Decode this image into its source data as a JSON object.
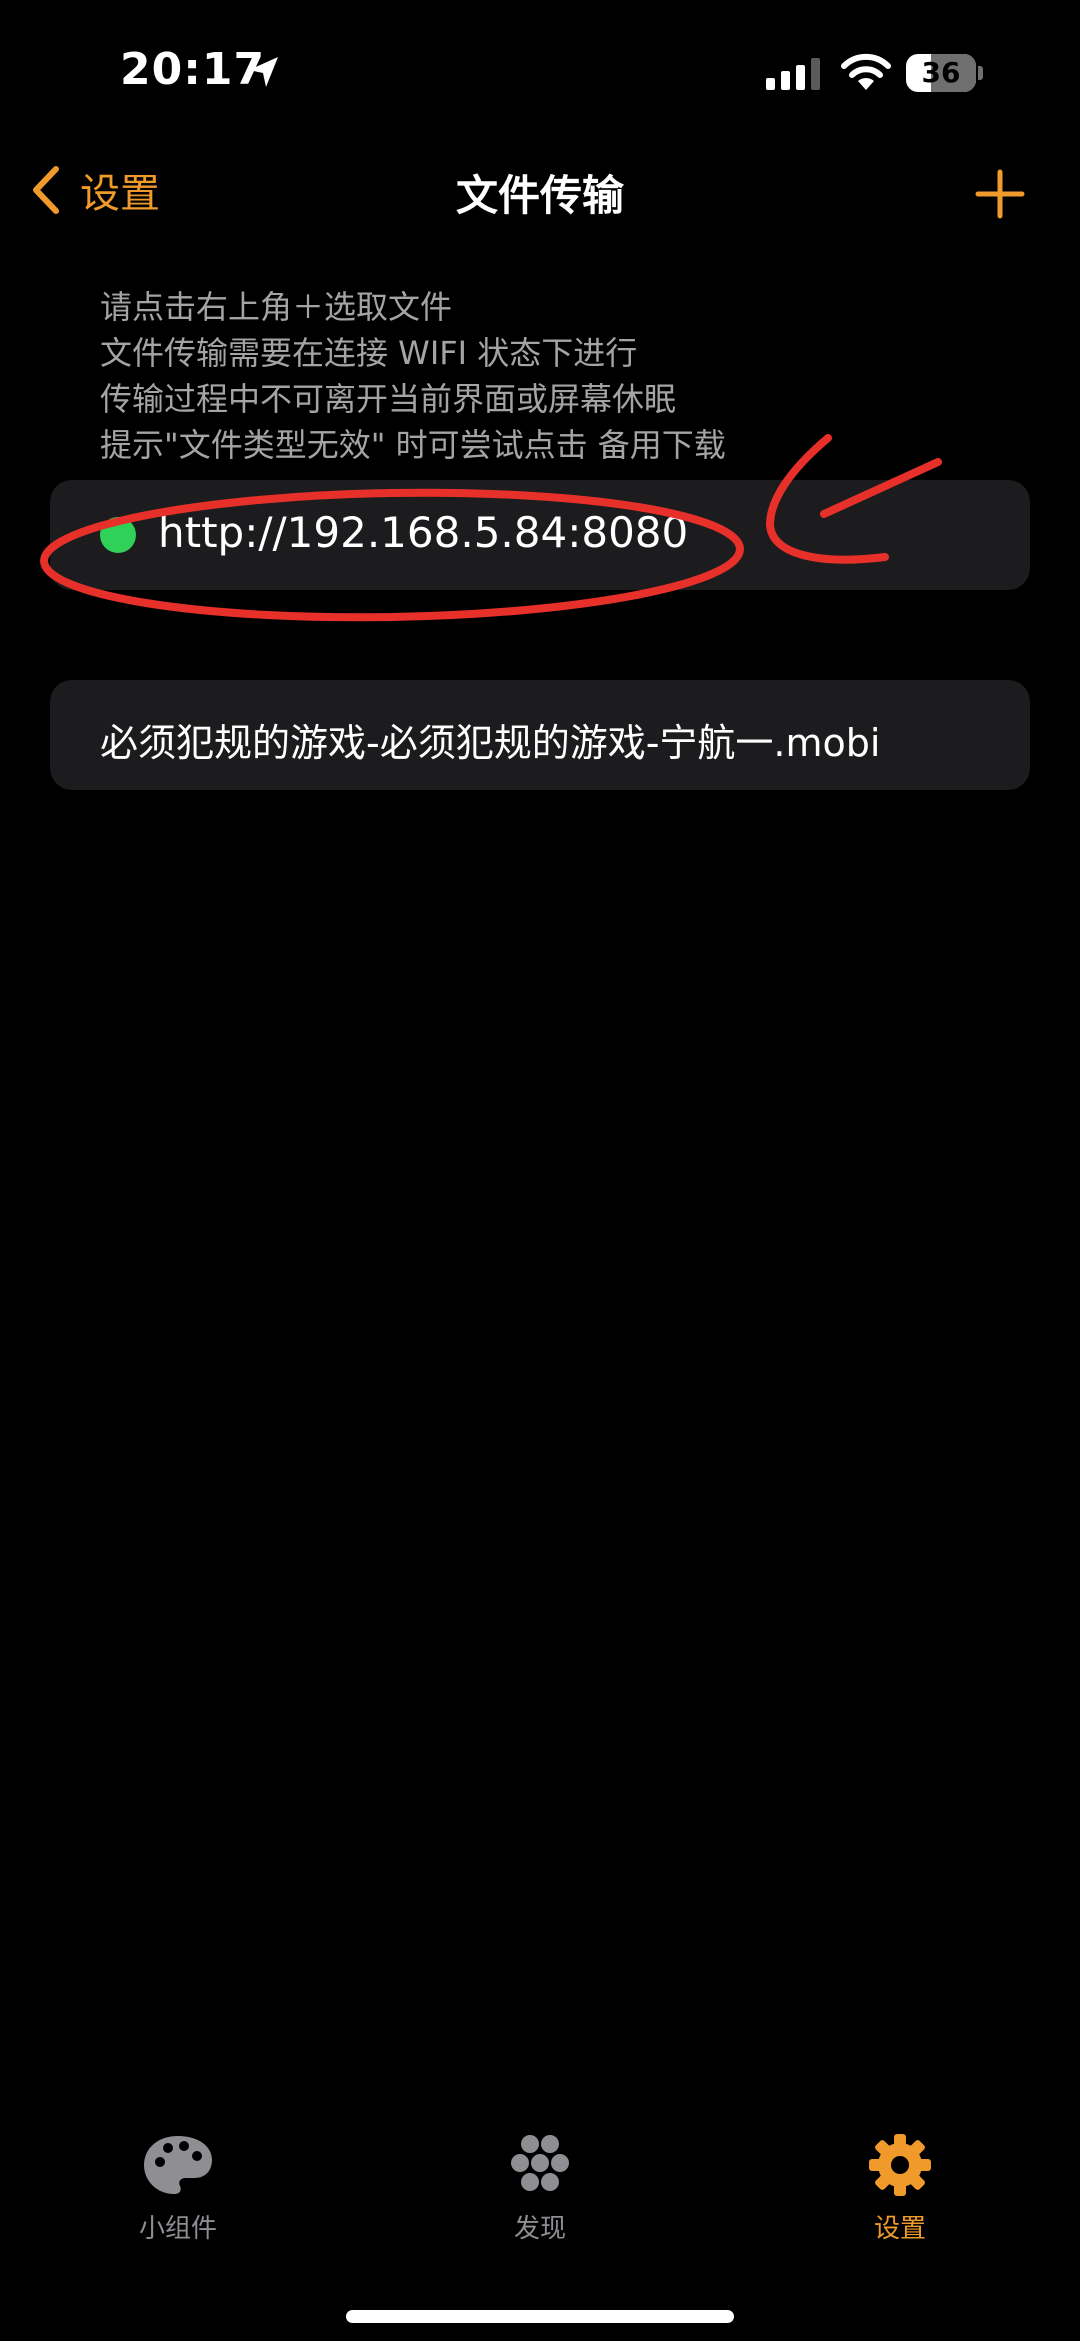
{
  "status_bar": {
    "time": "20:17",
    "battery": "36",
    "battery_level": 0.36,
    "icons": [
      "location-arrow-icon",
      "cellular-signal-icon",
      "wifi-icon",
      "battery-icon"
    ]
  },
  "nav": {
    "back_label": "设置",
    "title": "文件传输",
    "add_icon": "plus-icon"
  },
  "instructions": [
    "请点击右上角＋选取文件",
    "文件传输需要在连接 WIFI 状态下进行",
    "传输过程中不可离开当前界面或屏幕休眠",
    "提示\"文件类型无效\" 时可尝试点击 备用下载"
  ],
  "server": {
    "url": "http://192.168.5.84:8080",
    "status_color": "#30d158"
  },
  "files": [
    {
      "name": "必须犯规的游戏-必须犯规的游戏-宁航一.mobi"
    }
  ],
  "annotation": {
    "color": "#e8302a",
    "marks": [
      "circle-around-url",
      "arrow-pointing-to-url"
    ]
  },
  "tab_bar": {
    "tabs": [
      {
        "label": "小组件",
        "icon": "palette-icon",
        "active": false
      },
      {
        "label": "发现",
        "icon": "flower-dots-icon",
        "active": false
      },
      {
        "label": "设置",
        "icon": "gear-icon",
        "active": true
      }
    ]
  },
  "colors": {
    "accent": "#f09a2b",
    "background": "#000000",
    "card": "#1c1c1e",
    "secondary_text": "#a4a4a4",
    "inactive_tab": "#8e8e93"
  }
}
